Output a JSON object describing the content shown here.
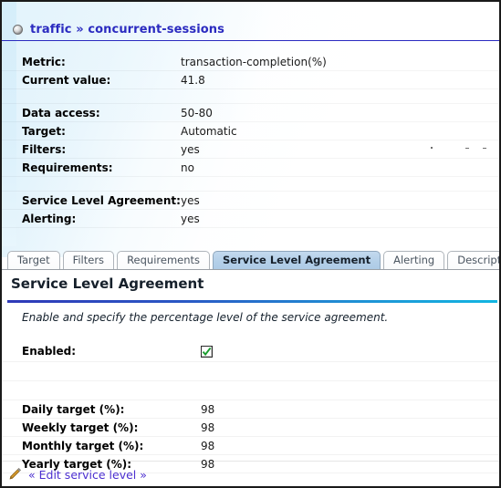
{
  "breadcrumb": {
    "bullet_icon": "radio-bullet-icon",
    "text": "traffic » concurrent-sessions"
  },
  "summary": [
    {
      "label": "Metric:",
      "value": "transaction-completion(%)"
    },
    {
      "label": "Current value:",
      "value": "41.8"
    },
    {
      "label": "Data access:",
      "value": "50-80"
    },
    {
      "label": "Target:",
      "value": "Automatic"
    },
    {
      "label": "Filters:",
      "value": "yes"
    },
    {
      "label": "Requirements:",
      "value": "no"
    },
    {
      "label": "Service Level Agreement:",
      "value": "yes"
    },
    {
      "label": "Alerting:",
      "value": "yes"
    }
  ],
  "tabs": [
    {
      "label": "Target",
      "active": false
    },
    {
      "label": "Filters",
      "active": false
    },
    {
      "label": "Requirements",
      "active": false
    },
    {
      "label": "Service Level Agreement",
      "active": true
    },
    {
      "label": "Alerting",
      "active": false
    },
    {
      "label": "Description",
      "active": false
    }
  ],
  "panel": {
    "title": "Service Level Agreement",
    "hint": "Enable and specify the percentage level of the service agreement.",
    "enabled_label": "Enabled:",
    "enabled_checked": true,
    "fields": [
      {
        "label": "Daily target (%):",
        "value": "98"
      },
      {
        "label": "Weekly target (%):",
        "value": "98"
      },
      {
        "label": "Monthly target (%):",
        "value": "98"
      },
      {
        "label": "Yearly target (%):",
        "value": "98"
      }
    ]
  },
  "footer": {
    "pencil_icon": "pencil-edit-icon",
    "edit_label": "« Edit service level »"
  },
  "colors": {
    "breadcrumb_text": "#2b2bc0",
    "rule_start": "#2f39b8",
    "rule_end": "#12b6e2",
    "active_tab_bg": "#b3cfe8",
    "link": "#4b2fd0",
    "check_green": "#1a9d2e"
  }
}
